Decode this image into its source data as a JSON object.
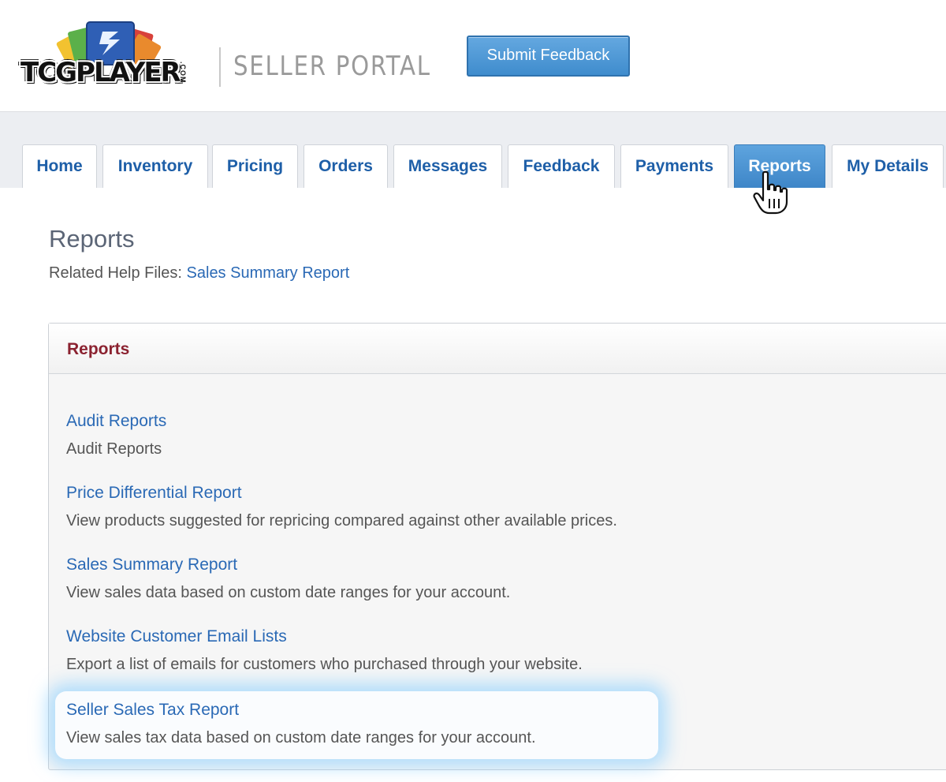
{
  "header": {
    "logo_text": "TCGPLAYER",
    "logo_suffix": ".COM",
    "portal_title": "SELLER PORTAL",
    "feedback_button": "Submit Feedback"
  },
  "nav": {
    "tabs": [
      {
        "label": "Home"
      },
      {
        "label": "Inventory"
      },
      {
        "label": "Pricing"
      },
      {
        "label": "Orders"
      },
      {
        "label": "Messages"
      },
      {
        "label": "Feedback"
      },
      {
        "label": "Payments"
      },
      {
        "label": "Reports",
        "active": true
      },
      {
        "label": "My Details"
      }
    ]
  },
  "page": {
    "title": "Reports",
    "help_prefix": "Related Help Files:",
    "help_link": "Sales Summary Report"
  },
  "panel": {
    "title": "Reports",
    "reports": [
      {
        "name": "Audit Reports",
        "description": "Audit Reports"
      },
      {
        "name": "Price Differential Report",
        "description": "View products suggested for repricing compared against other available prices."
      },
      {
        "name": "Sales Summary Report",
        "description": "View sales data based on custom date ranges for your account."
      },
      {
        "name": "Website Customer Email Lists",
        "description": "Export a list of emails for customers who purchased through your website."
      },
      {
        "name": "Seller Sales Tax Report",
        "description": "View sales tax data based on custom date ranges for your account.",
        "highlighted": true
      }
    ]
  },
  "colors": {
    "link": "#2a69b5",
    "panel_title": "#8b2230",
    "active_tab": "#4a93d3",
    "highlight_glow": "#78c8ff"
  },
  "icons": {
    "cursor": "hand-pointer-icon"
  }
}
